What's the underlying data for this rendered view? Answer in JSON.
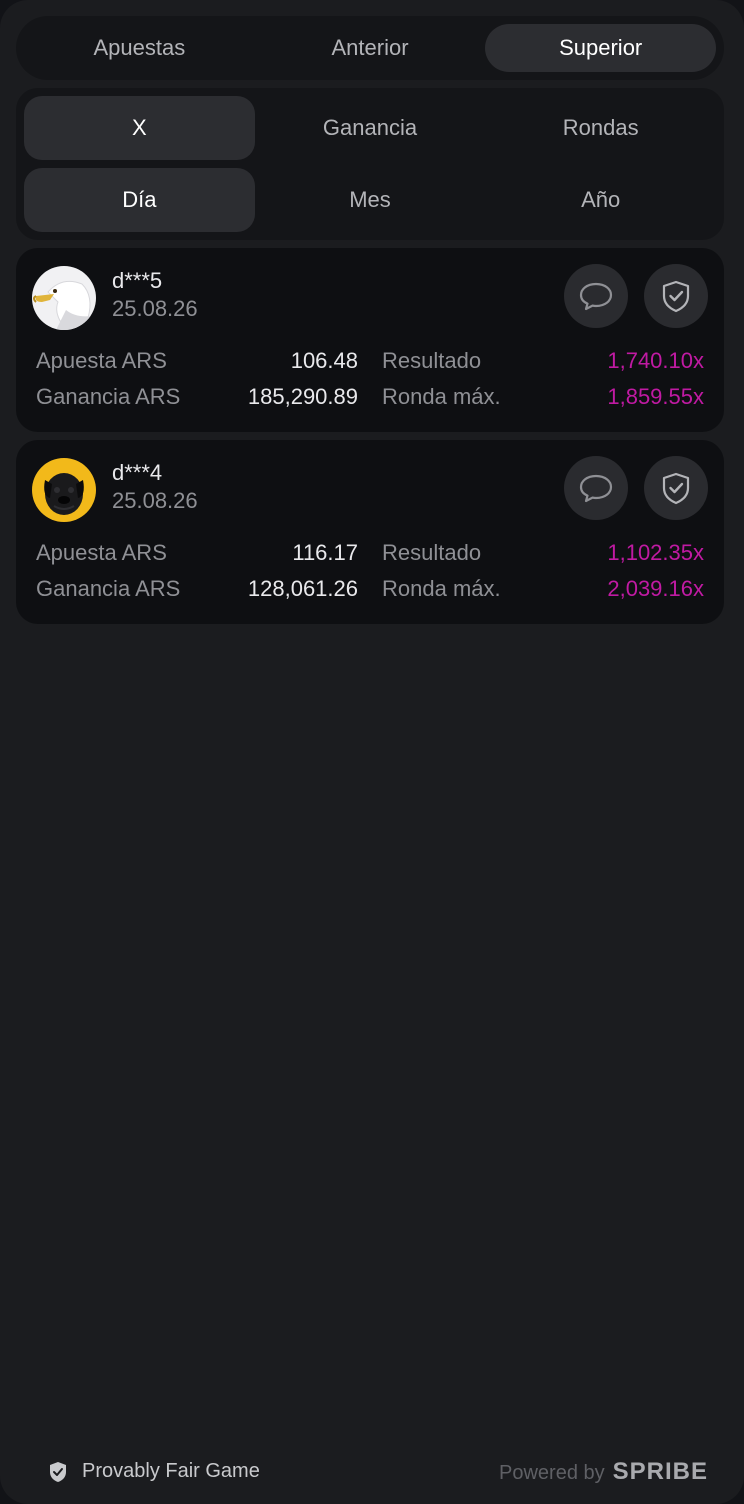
{
  "tabs": [
    {
      "label": "Apuestas",
      "active": false
    },
    {
      "label": "Anterior",
      "active": false
    },
    {
      "label": "Superior",
      "active": true
    }
  ],
  "filters": {
    "row1": [
      {
        "label": "X",
        "active": true
      },
      {
        "label": "Ganancia",
        "active": false
      },
      {
        "label": "Rondas",
        "active": false
      }
    ],
    "row2": [
      {
        "label": "Día",
        "active": true
      },
      {
        "label": "Mes",
        "active": false
      },
      {
        "label": "Año",
        "active": false
      }
    ]
  },
  "bets": [
    {
      "user": "d***5",
      "date": "25.08.26",
      "avatar": "eagle",
      "bet_label": "Apuesta ARS",
      "bet_value": "106.48",
      "win_label": "Ganancia ARS",
      "win_value": "185,290.89",
      "result_label": "Resultado",
      "result_value": "1,740.10x",
      "max_label": "Ronda máx.",
      "max_value": "1,859.55x"
    },
    {
      "user": "d***4",
      "date": "25.08.26",
      "avatar": "pug",
      "bet_label": "Apuesta ARS",
      "bet_value": "116.17",
      "win_label": "Ganancia ARS",
      "win_value": "128,061.26",
      "result_label": "Resultado",
      "result_value": "1,102.35x",
      "max_label": "Ronda máx.",
      "max_value": "2,039.16x"
    }
  ],
  "icons": {
    "chat": "chat-bubble-icon",
    "verify": "shield-check-icon"
  },
  "colors": {
    "multiplier": "#c01aa3",
    "background": "#1b1c1f"
  },
  "footer": {
    "provably_fair": "Provably Fair Game",
    "powered_by": "Powered by",
    "brand": "SPRIBE"
  }
}
